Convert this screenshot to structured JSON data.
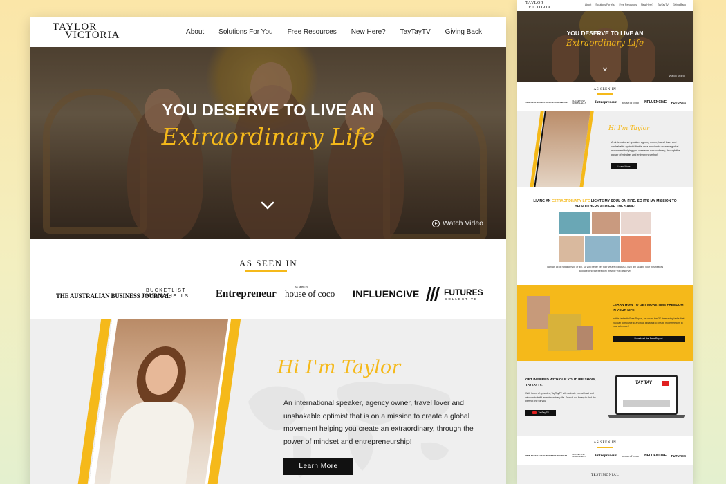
{
  "colors": {
    "accent": "#f5b91a",
    "dark": "#111111",
    "light_bg": "#efefef"
  },
  "brand": {
    "logo_line1": "TAYLOR",
    "logo_line2": "VICTORIA"
  },
  "nav": {
    "items": [
      {
        "label": "About"
      },
      {
        "label": "Solutions For You"
      },
      {
        "label": "Free Resources"
      },
      {
        "label": "New Here?"
      },
      {
        "label": "TayTayTV"
      },
      {
        "label": "Giving Back"
      }
    ]
  },
  "hero": {
    "title": "YOU DESERVE TO LIVE AN",
    "script": "Extraordinary Life",
    "scroll_icon": "chevron-down-icon",
    "watch_label": "Watch Video",
    "watch_icon": "play-circle-icon"
  },
  "as_seen_in": {
    "title": "AS SEEN IN",
    "logos": [
      "THE AUSTRALIAN BUSINESS JOURNAL",
      "BUCKETLIST BOMBSHELLS",
      "Entrepreneur",
      "As seen in",
      "house of coco",
      "INFLUENCIVE",
      "FUTURES",
      "COLLECTIVE"
    ]
  },
  "about": {
    "script": "Hi I'm Taylor",
    "text": "An international speaker, agency owner, travel lover and unshakable optimist that is on a mission to create a global movement helping you create an extraordinary, through the power of mindset and entrepreneurship!",
    "button": "Learn More"
  },
  "preview": {
    "mission_pre": "LIVING AN",
    "mission_highlight": "EXTRAORDINARY LIFE",
    "mission_post": "LIGHTS MY SOUL ON FIRE. SO IT'S MY MISSION TO HELP OTHERS ACHIEVE THE SAME!",
    "mission_text": "I am an all or nothing type of girl, so you better bet that we are going ALL IN! I am scaling your businesses and creating the freedom lifestyle you deserve!",
    "report_title": "LEARN HOW TO GET MORE TIME FREEDOM IN YOUR LIFE!",
    "report_text": "In this fantastic Free Report, we share the 37 timesaving tasks that you can outsource to a virtual assistant to create more freedom in your schedule!",
    "report_button": "Download the Free Report",
    "yt_title": "GET INSPIRED WITH OUR YOUTUBE SHOW, TAYTAYTV.",
    "yt_text": "With hours of episodes, TayTayTV will motivate you with wit and wisdom to build an extraordinary life. Search our library to find the perfect one for you.",
    "yt_button": "TayTayTV",
    "yt_screen_label": "TAY TAY",
    "testimonial_title": "TESTIMONIAL"
  }
}
